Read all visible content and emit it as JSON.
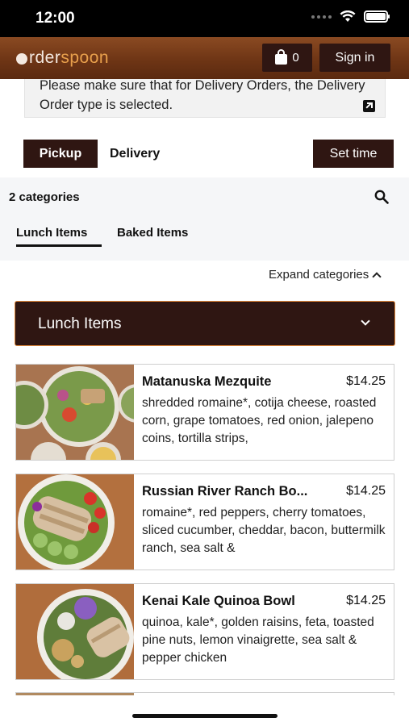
{
  "status_bar": {
    "time": "12:00"
  },
  "header": {
    "logo_first": "rder",
    "logo_second": "spoon",
    "cart_count": "0",
    "signin_label": "Sign in"
  },
  "notice": {
    "text": "Please make sure that for Delivery Orders, the Delivery Order type is selected."
  },
  "order_type": {
    "pickup_label": "Pickup",
    "delivery_label": "Delivery",
    "set_time_label": "Set time",
    "selected": "Pickup"
  },
  "categories": {
    "count_label": "2 categories",
    "tabs": [
      {
        "label": "Lunch Items",
        "active": true
      },
      {
        "label": "Baked Items",
        "active": false
      }
    ],
    "expand_label": "Expand categories"
  },
  "category_section": {
    "title": "Lunch Items"
  },
  "items": [
    {
      "name": "Matanuska Mezquite",
      "price": "$14.25",
      "description": "shredded romaine*, cotija cheese, roasted corn, grape tomatoes, red onion, jalepeno coins, tortilla strips,"
    },
    {
      "name": "Russian River Ranch Bo...",
      "price": "$14.25",
      "description": "romaine*, red peppers, cherry tomatoes, sliced cucumber, cheddar, bacon, buttermilk ranch, sea salt &"
    },
    {
      "name": "Kenai Kale Quinoa Bowl",
      "price": "$14.25",
      "description": "quinoa, kale*, golden raisins, feta, toasted pine nuts, lemon vinaigrette, sea salt & pepper chicken"
    }
  ],
  "colors": {
    "brand_dark": "#2f1612",
    "header_brown": "#6e3515",
    "accent_orange": "#e2883a",
    "logo_accent": "#e8a04c"
  }
}
